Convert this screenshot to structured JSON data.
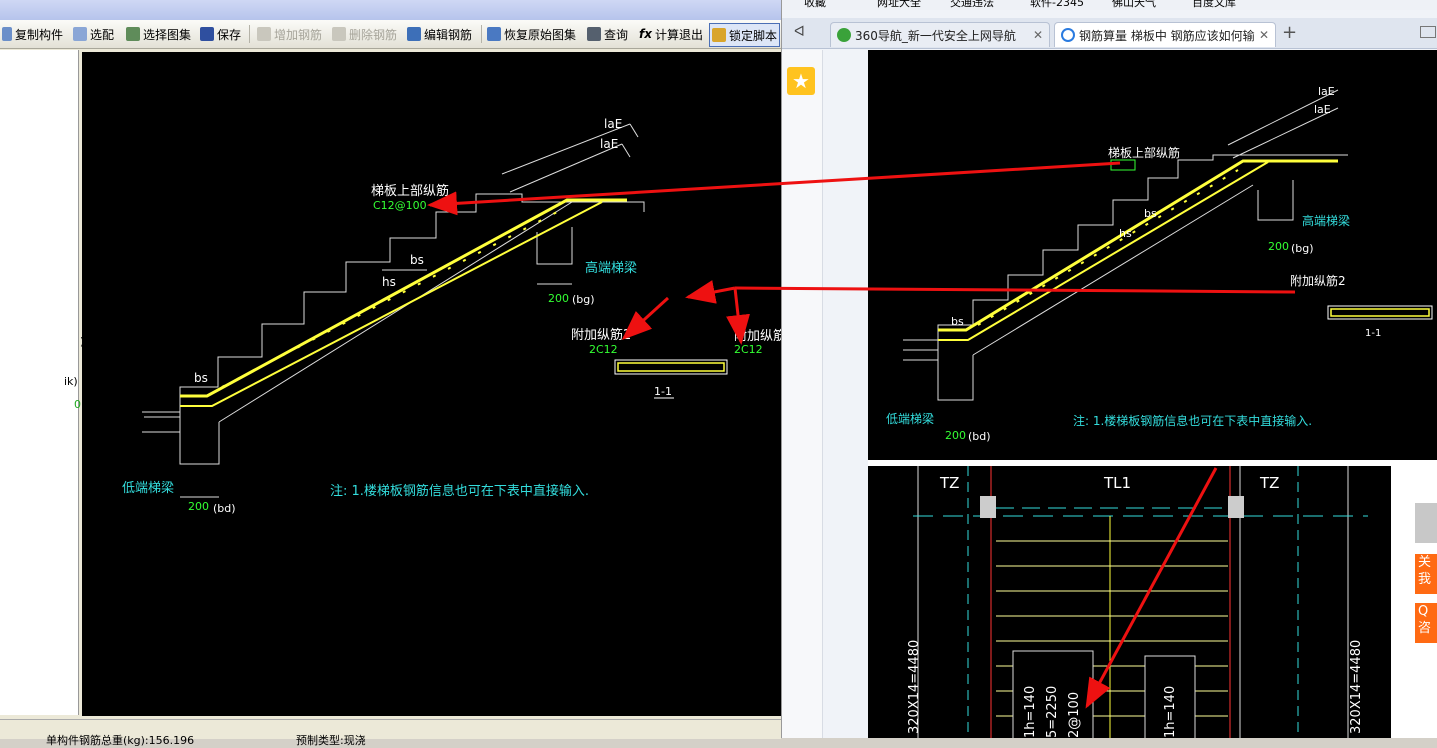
{
  "left_app": {
    "toolbar": {
      "copy_component": "复制构件",
      "select_config": "选配",
      "select_atlas": "选择图集",
      "save": "保存",
      "add_rebar": "增加钢筋",
      "delete_rebar": "删除钢筋",
      "edit_rebar": "编辑钢筋",
      "restore_atlas": "恢复原始图集",
      "query": "查询",
      "calc_exit": "计算退出",
      "lock_script": "锁定脚本"
    },
    "left_panel": {
      "t1": ")",
      "t2": "ik)",
      "t3": "0"
    },
    "drawing": {
      "lae1": "laE",
      "lae2": "laE",
      "top_rebar_label": "梯板上部纵筋",
      "top_rebar_spec": "C12@100",
      "bs_top": "bs",
      "hs": "hs",
      "high_beam": "高端梯梁",
      "dim_200_bg": "200",
      "bg": "(bg)",
      "extra_rebar2": "附加纵筋2",
      "extra_rebar2_spec": "2C12",
      "extra_rebar": "附加纵筋",
      "extra_rebar_spec": "2C12",
      "section": "1-1",
      "bs_bottom": "bs",
      "low_beam": "低端梯梁",
      "dim_200_bd": "200",
      "bd": "(bd)",
      "note": "注: 1.楼梯板钢筋信息也可在下表中直接输入."
    },
    "status": {
      "total": "单构件钢筋总重(kg):156.196",
      "type": "预制类型:现浇"
    }
  },
  "browser": {
    "favorites": {
      "fav": "收藏",
      "site_nav": "网址大全",
      "traffic": "交通违法",
      "software": "软件-2345",
      "foshan": "佛山天气",
      "baidu": "百度文库"
    },
    "tabs": [
      {
        "label": "360导航_新一代安全上网导航"
      },
      {
        "label": "钢筋算量 梯板中 钢筋应该如何输"
      }
    ],
    "new_tab": "+",
    "drawing_top": {
      "lae1": "laE",
      "lae2": "laE",
      "top_rebar_label": "梯板上部纵筋",
      "bs": "bs",
      "hs": "hs",
      "high_beam": "高端梯梁",
      "dim_200": "200",
      "bg": "(bg)",
      "extra_rebar2": "附加纵筋2",
      "section": "1-1",
      "bs_bottom": "bs",
      "low_beam": "低端梯梁",
      "dim_200_bd": "200",
      "bd": "(bd)",
      "note": "注: 1.楼梯板钢筋信息也可在下表中直接输入."
    },
    "drawing_plan": {
      "tz_left": "TZ",
      "tl1": "TL1",
      "tz_right": "TZ",
      "dim_left": "320X14=4480",
      "dim_right": "320X14=4480",
      "v1": "1h=140",
      "v2": "5=2250",
      "v3": "2@100",
      "v4": "1h=140"
    },
    "float": {
      "close": "关",
      "me": "我",
      "q": "Q",
      "consult": "咨"
    }
  }
}
